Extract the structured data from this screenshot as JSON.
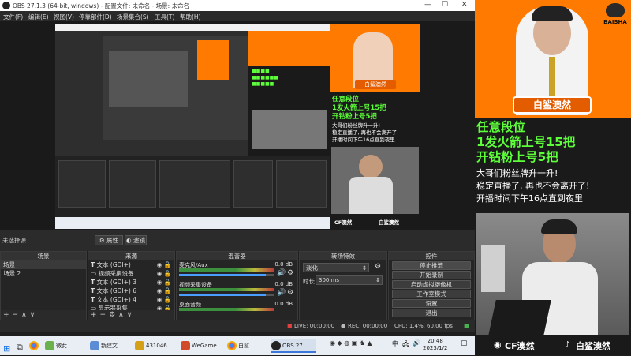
{
  "window": {
    "title": "OBS 27.1.3 (64-bit, windows) - 配置文件: 未命名 - 场景: 未命名"
  },
  "menu": [
    "文件(F)",
    "编辑(E)",
    "视图(V)",
    "停靠部件(D)",
    "场景集合(S)",
    "工具(T)",
    "帮助(H)"
  ],
  "preview": {
    "stream_name": "白鲨澳然",
    "promo_lines": [
      "任意段位",
      "1发火箭上号15把",
      "开钻粉上号5把"
    ],
    "note_lines": [
      "大哥们粉丝牌升一升!",
      "稳定直播了, 再也不会离开了!",
      "开播时间下午16点直到夜里"
    ],
    "footer_cf": "CF澳然",
    "footer_tiktok": "白鲨澳然"
  },
  "scene_bar": {
    "none_selected": "未选择源",
    "properties_btn": "属性",
    "filters_btn": "滤镜"
  },
  "scenes": {
    "header": "场景",
    "items": [
      "场景",
      "场景 2"
    ]
  },
  "sources": {
    "header": "来源",
    "items": [
      "文本 (GDI+)",
      "视频采集设备",
      "文本 (GDI+) 3",
      "文本 (GDI+) 6",
      "文本 (GDI+) 4",
      "显示器采集"
    ]
  },
  "mixer": {
    "header": "混音器",
    "channels": [
      {
        "name": "麦克风/Aux",
        "db": "0.0 dB"
      },
      {
        "name": "视频采集设备",
        "db": "0.0 dB"
      },
      {
        "name": "桌面音频",
        "db": "0.0 dB"
      }
    ]
  },
  "transitions": {
    "header": "转场特效",
    "selected": "淡化",
    "duration_label": "时长",
    "duration_value": "300 ms"
  },
  "controls": {
    "header": "控件",
    "buttons": [
      "停止推流",
      "开始录制",
      "启动虚拟摄像机",
      "工作室模式",
      "设置",
      "退出"
    ]
  },
  "status": {
    "live": "LIVE: 00:00:00",
    "rec": "REC: 00:00:00",
    "cpu": "CPU: 1.4%, 60.00 fps"
  },
  "taskbar": {
    "items": [
      "微女...",
      "新建文...",
      "431046...",
      "WeGame",
      "白鲨...",
      "OBS 27..."
    ],
    "time": "20:48",
    "date": "2023/1/2",
    "ime": "中"
  },
  "stream_panel": {
    "brand": "BAISHA"
  }
}
